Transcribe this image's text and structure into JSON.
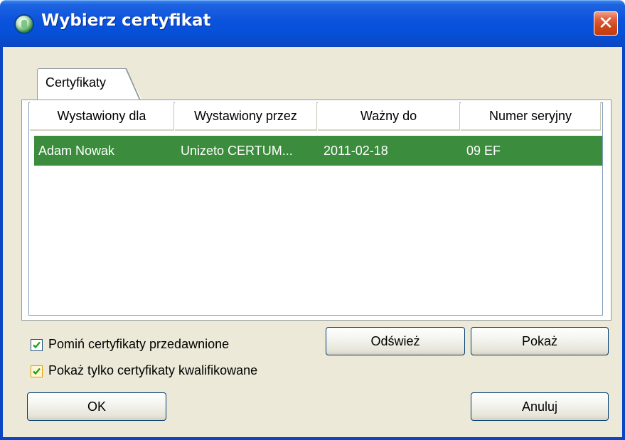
{
  "window": {
    "title": "Wybierz certyfikat",
    "close_glyph": "✕"
  },
  "tab": {
    "label": "Certyfikaty"
  },
  "table": {
    "columns": [
      "Wystawiony dla",
      "Wystawiony przez",
      "Ważny do",
      "Numer seryjny"
    ],
    "rows": [
      [
        "Adam Nowak",
        "Unizeto CERTUM...",
        "2011-02-18",
        "09 EF"
      ]
    ],
    "selected_row_color": "#3b8c3d"
  },
  "options": {
    "skip_expired_label": "Pomiń certyfikaty przedawnione",
    "skip_expired_checked": true,
    "qualified_only_label": "Pokaż tylko certyfikaty kwalifikowane",
    "qualified_only_checked": true
  },
  "buttons": {
    "refresh": "Odśwież",
    "show": "Pokaż",
    "ok": "OK",
    "cancel": "Anuluj"
  }
}
